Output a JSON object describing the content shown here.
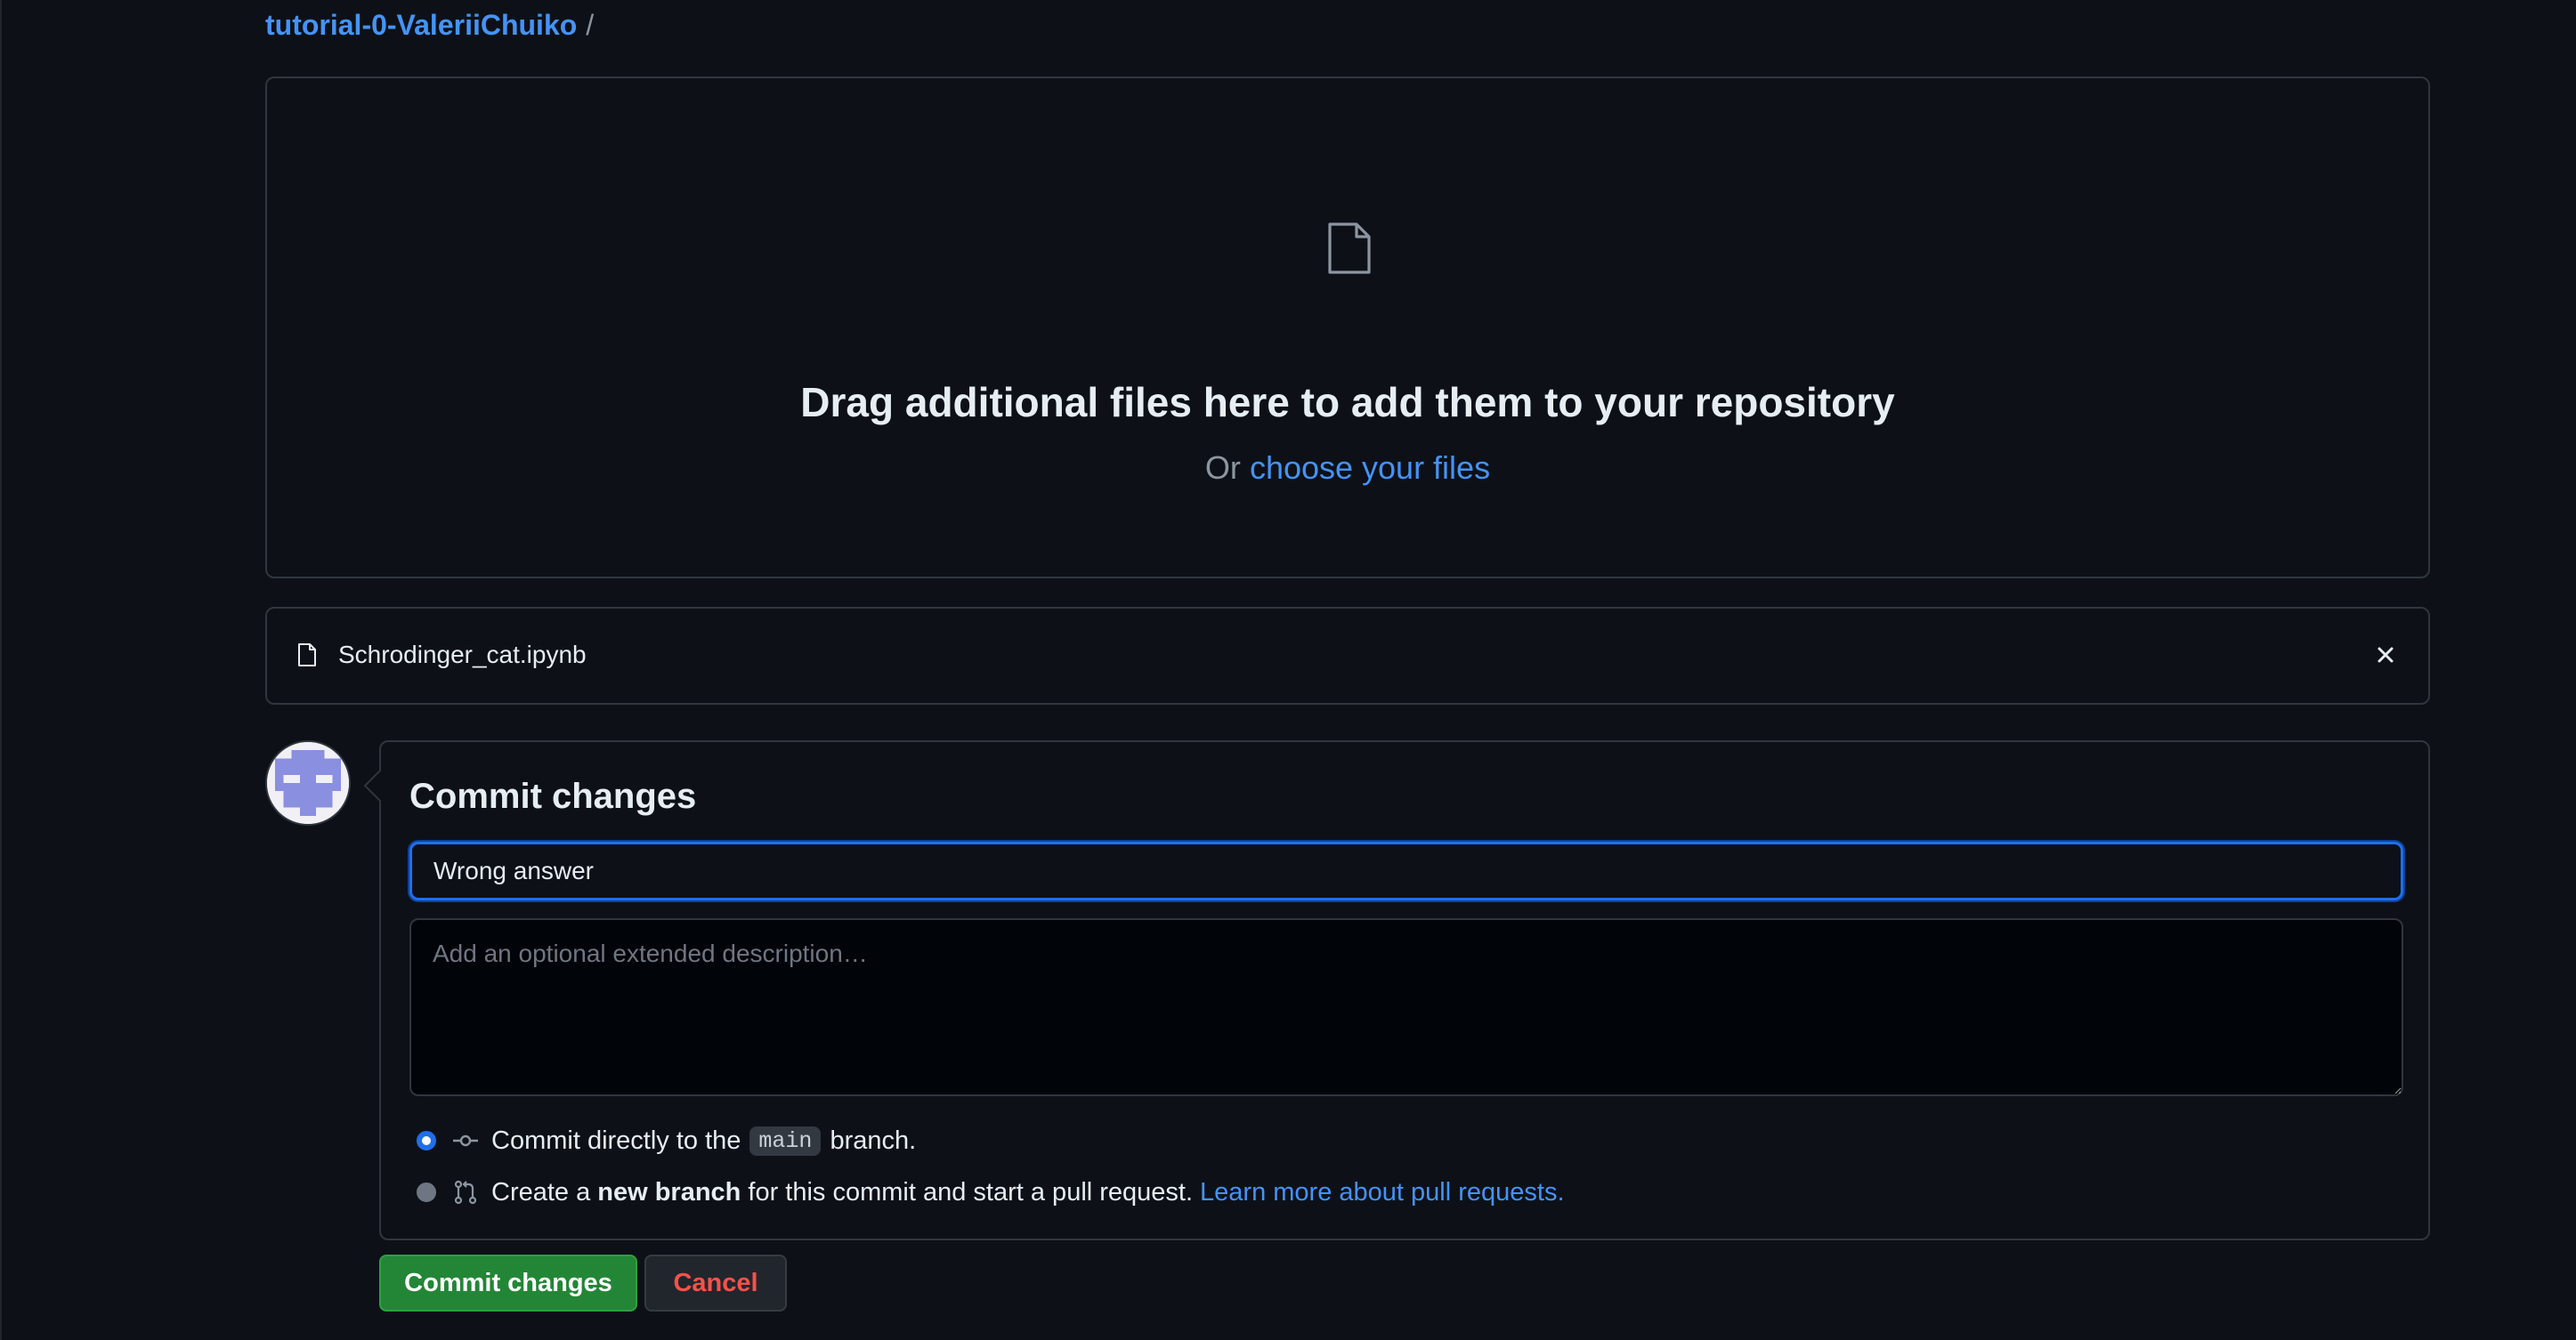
{
  "breadcrumb": {
    "repo": "tutorial-0-ValeriiChuiko",
    "separator": "/"
  },
  "dropzone": {
    "icon": "file-icon",
    "title": "Drag additional files here to add them to your repository",
    "prefix": "Or",
    "link": "choose your files"
  },
  "files": [
    {
      "name": "Schrodinger_cat.ipynb",
      "icon": "file-icon",
      "remove_icon": "close-icon"
    }
  ],
  "commit": {
    "title": "Commit changes",
    "summary_value": "Wrong answer",
    "description_placeholder": "Add an optional extended description…",
    "option_direct": {
      "checked": true,
      "icon": "git-commit-icon",
      "before": "Commit directly to the",
      "branch": "main",
      "after": "branch."
    },
    "option_new_branch": {
      "checked": false,
      "icon": "git-pull-request-icon",
      "before": "Create a",
      "bold": "new branch",
      "after": "for this commit and start a pull request.",
      "link": "Learn more about pull requests."
    }
  },
  "buttons": {
    "commit": "Commit changes",
    "cancel": "Cancel"
  },
  "colors": {
    "background": "#0d1117",
    "border": "#30363d",
    "link": "#4493f8",
    "primary_button": "#238636",
    "danger_text": "#f85149",
    "focus_ring": "#1f6feb"
  }
}
